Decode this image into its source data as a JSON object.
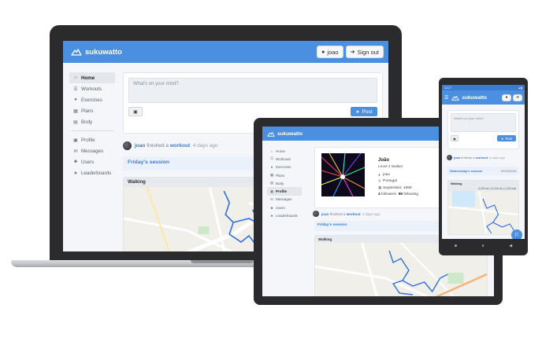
{
  "brand": {
    "name": "sukuwatto",
    "color": "#4a8fe0"
  },
  "laptop": {
    "header": {
      "user_label": "joao",
      "signout_label": "Sign out"
    },
    "sidebar": {
      "items": [
        {
          "label": "Home",
          "icon": "home-icon"
        },
        {
          "label": "Workouts",
          "icon": "list-icon"
        },
        {
          "label": "Exercises",
          "icon": "dumbbell-icon"
        },
        {
          "label": "Plans",
          "icon": "calendar-icon"
        },
        {
          "label": "Body",
          "icon": "body-icon"
        },
        {
          "label": "Profile",
          "icon": "id-card-icon"
        },
        {
          "label": "Messages",
          "icon": "comments-icon"
        },
        {
          "label": "Users",
          "icon": "users-icon"
        },
        {
          "label": "Leaderboards",
          "icon": "trophy-icon"
        }
      ]
    },
    "composer": {
      "placeholder": "What's on your mind?",
      "post_label": "Post"
    },
    "activity": {
      "user": "joao",
      "verb": "finished a",
      "object": "workout",
      "time": "4 days ago"
    },
    "session": {
      "title": "Friday's session"
    },
    "map": {
      "title": "Walking"
    }
  },
  "tablet": {
    "sidebar": {
      "items": [
        {
          "label": "Home"
        },
        {
          "label": "Workouts"
        },
        {
          "label": "Exercises"
        },
        {
          "label": "Plans"
        },
        {
          "label": "Body"
        },
        {
          "label": "Profile"
        },
        {
          "label": "Messages"
        },
        {
          "label": "Users"
        },
        {
          "label": "Leaderboards"
        }
      ]
    },
    "profile": {
      "name": "João",
      "level": "Level 4 Walker",
      "username": "joao",
      "country": "Portugal",
      "birth": "September, 1985",
      "followers_count": "4",
      "followers_label": "followers",
      "following_count": "98",
      "following_label": "following"
    },
    "activity": {
      "user": "joao",
      "verb": "finished a",
      "object": "workout",
      "time": "4 days ago"
    },
    "session": {
      "title": "Friday's session"
    },
    "map": {
      "title": "Walking"
    }
  },
  "phone": {
    "status": {
      "time": "12:27",
      "right": ""
    },
    "composer": {
      "placeholder": "What's on your mind?",
      "post_label": "Post"
    },
    "activity": {
      "user": "joao",
      "verb": "finished a",
      "object": "workout",
      "time": "6 days ago"
    },
    "session": {
      "title": "Wednesday's session",
      "date": "02/03/2021"
    },
    "map": {
      "title": "Walking",
      "stats": "6,292 km  |  1h 14m 4s  |  1,202 kcal"
    }
  },
  "colors": {
    "accent": "#4a8fe0",
    "route": "#2f6fe0",
    "map_bg": "#f1efe9"
  }
}
